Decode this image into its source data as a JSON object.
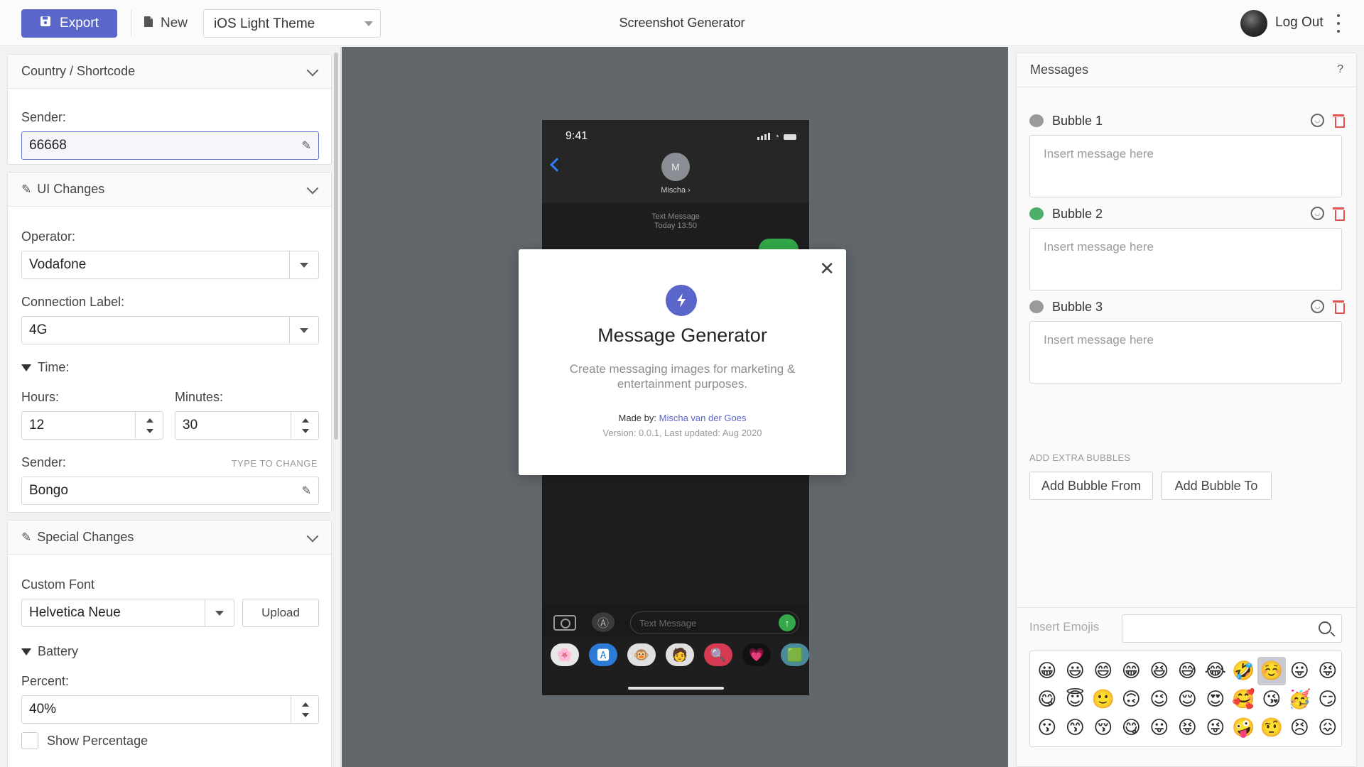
{
  "topbar": {
    "export_label": "Export",
    "new_label": "New",
    "theme_value": "iOS Light Theme",
    "app_title": "Screenshot Generator",
    "logout_label": "Log Out"
  },
  "left": {
    "country": {
      "title": "Country / Shortcode",
      "sender_label": "Sender:",
      "sender_value": "66668"
    },
    "ui": {
      "title": "UI Changes",
      "operator_label": "Operator:",
      "operator_value": "Vodafone",
      "connection_label": "Connection Label:",
      "connection_value": "4G",
      "time_label": "Time:",
      "hours_label": "Hours:",
      "hours_value": "12",
      "minutes_label": "Minutes:",
      "minutes_value": "30",
      "sender_label": "Sender:",
      "sender_hint": "TYPE TO CHANGE",
      "sender_value": "Bongo"
    },
    "special": {
      "title": "Special Changes",
      "font_label": "Custom Font",
      "font_value": "Helvetica Neue",
      "upload_label": "Upload",
      "battery_label": "Battery",
      "percent_label": "Percent:",
      "percent_value": "40%",
      "show_percentage_label": "Show Percentage"
    }
  },
  "phone": {
    "time": "9:41",
    "contact_initial": "M",
    "contact_name": "Mischa ›",
    "meta_line1": "Text Message",
    "meta_line2": "Today 13:50",
    "input_placeholder": "Text Message",
    "apps": [
      "🌸",
      "🅰",
      "🐵",
      "🧑",
      "🔍",
      "💗",
      "🟩"
    ],
    "colors": {
      "send": "#34a84a",
      "back": "#2f7df6"
    }
  },
  "modal": {
    "title": "Message Generator",
    "description": "Create messaging images for marketing & entertainment purposes.",
    "made_by_label": "Made by:",
    "author": "Mischa van der Goes",
    "version": "Version: 0.0.1, Last updated: Aug 2020"
  },
  "right": {
    "title": "Messages",
    "help": "?",
    "bubbles": [
      {
        "label": "Bubble 1",
        "placeholder": "Insert message here",
        "color": "#9a9a9a"
      },
      {
        "label": "Bubble 2",
        "placeholder": "Insert message here",
        "color": "#4caf6a"
      },
      {
        "label": "Bubble 3",
        "placeholder": "Insert message here",
        "color": "#9a9a9a"
      }
    ],
    "extra_label": "ADD EXTRA BUBBLES",
    "add_from_label": "Add Bubble From",
    "add_to_label": "Add Bubble To",
    "emoji_label": "Insert Emojis",
    "emojis": [
      "😀",
      "😃",
      "😄",
      "😁",
      "😆",
      "😅",
      "😂",
      "🤣",
      "☺️",
      "😛",
      "😝",
      "😋",
      "😇",
      "🙂",
      "🙃",
      "😉",
      "😌",
      "😍",
      "🥰",
      "😘",
      "🥳",
      "😏",
      "😗",
      "😙",
      "😚",
      "😋",
      "😛",
      "😝",
      "😜",
      "🤪",
      "🤨",
      "😣",
      "😖"
    ],
    "selected_emoji_index": 8
  },
  "accent": "#5a66c9"
}
